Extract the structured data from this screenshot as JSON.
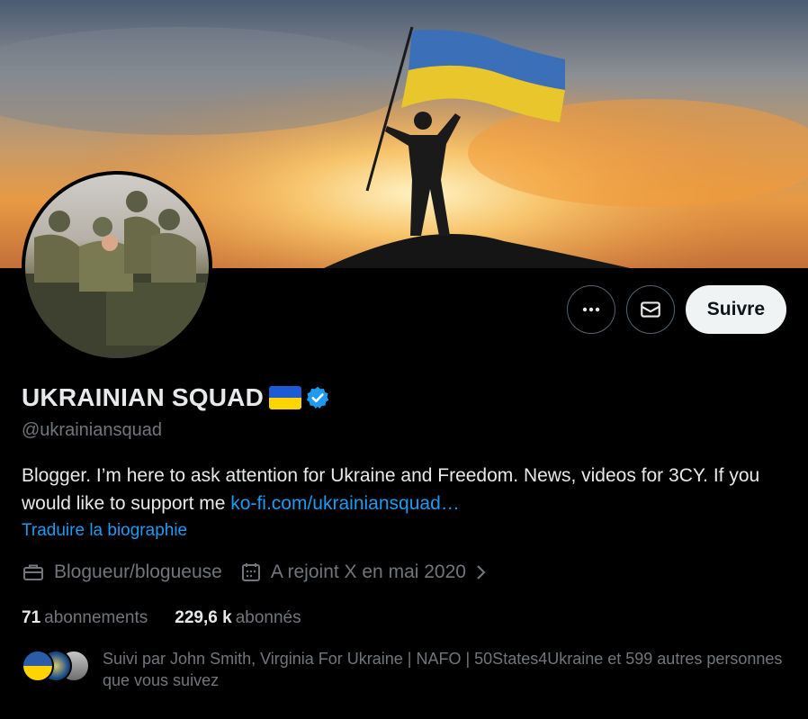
{
  "profile": {
    "display_name": "UKRAINIAN SQUAD",
    "handle": "@ukrainiansquad",
    "bio_text": "Blogger. I’m here to ask attention for Ukraine and Freedom. News, videos for 3CY. If you would like to support me ",
    "bio_link": "ko-fi.com/ukrainiansquad…",
    "translate_label": "Traduire la biographie",
    "category": "Blogueur/blogueuse",
    "joined": "A rejoint X en mai 2020"
  },
  "actions": {
    "more_icon": "more-dots-icon",
    "message_icon": "envelope-icon",
    "follow_label": "Suivre"
  },
  "stats": {
    "following_count": "71",
    "following_label": "abonnements",
    "followers_count": "229,6 k",
    "followers_label": "abonnés"
  },
  "followed_by": {
    "text": "Suivi par John Smith, Virginia For Ukraine | NAFO | 50States4Ukraine et 599 autres personnes que vous suivez"
  },
  "colors": {
    "accent": "#1d9bf0",
    "background": "#000000",
    "flag_blue": "#1d5bd6",
    "flag_yellow": "#ffd400"
  }
}
